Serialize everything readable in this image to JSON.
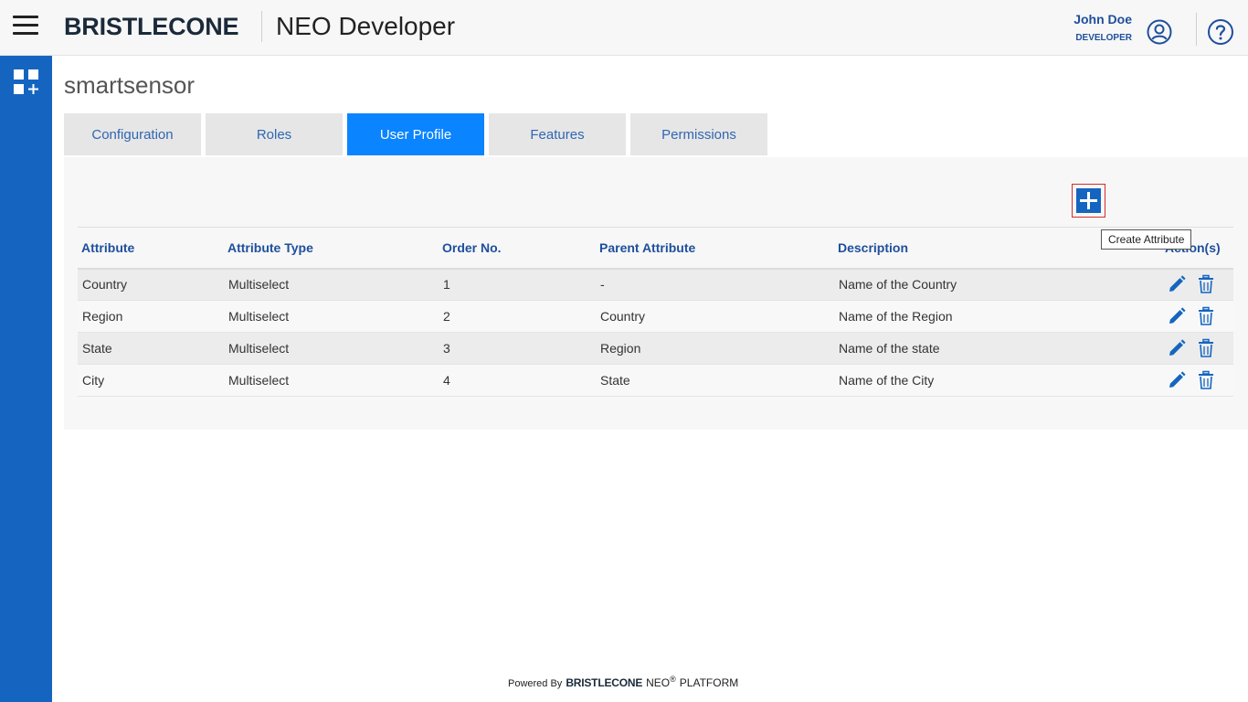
{
  "header": {
    "brand": "BRISTLECONE",
    "app_title": "NEO Developer",
    "user_name": "John Doe",
    "user_role": "DEVELOPER"
  },
  "page": {
    "title": "smartsensor"
  },
  "tabs": [
    {
      "label": "Configuration",
      "active": false
    },
    {
      "label": "Roles",
      "active": false
    },
    {
      "label": "User Profile",
      "active": true
    },
    {
      "label": "Features",
      "active": false
    },
    {
      "label": "Permissions",
      "active": false
    }
  ],
  "toolbar": {
    "create_tooltip": "Create Attribute"
  },
  "table": {
    "columns": [
      "Attribute",
      "Attribute Type",
      "Order No.",
      "Parent Attribute",
      "Description",
      "Action(s)"
    ],
    "rows": [
      {
        "attribute": "Country",
        "type": "Multiselect",
        "order": "1",
        "parent": "-",
        "description": "Name of the Country"
      },
      {
        "attribute": "Region",
        "type": "Multiselect",
        "order": "2",
        "parent": "Country",
        "description": "Name of the Region"
      },
      {
        "attribute": "State",
        "type": "Multiselect",
        "order": "3",
        "parent": "Region",
        "description": "Name of the state"
      },
      {
        "attribute": "City",
        "type": "Multiselect",
        "order": "4",
        "parent": "State",
        "description": "Name of the City"
      }
    ]
  },
  "footer": {
    "powered_by": "Powered By",
    "brand": "BRISTLECONE",
    "product": "NEO",
    "registered": "®",
    "platform": "PLATFORM"
  },
  "colors": {
    "primary": "#1565c0",
    "active_tab": "#0a84ff",
    "header_text": "#1e4f9c"
  }
}
